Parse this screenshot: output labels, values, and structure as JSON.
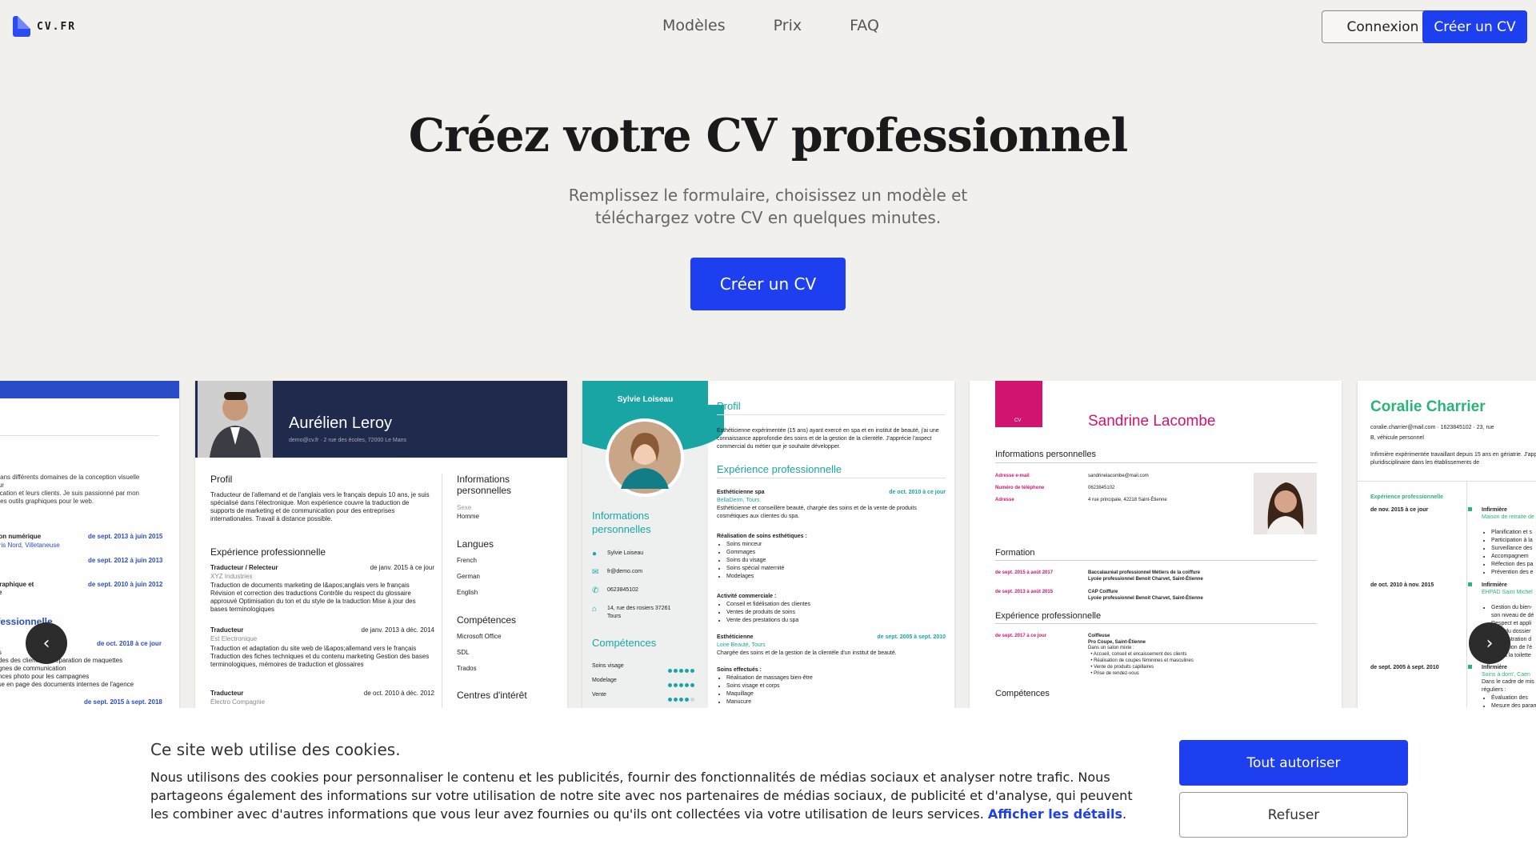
{
  "nav": {
    "logo_text": "CV.FR",
    "links": [
      "Modèles",
      "Prix",
      "FAQ"
    ],
    "login_label": "Connexion",
    "create_label": "Créer un CV"
  },
  "hero": {
    "title": "Créez votre CV professionnel",
    "subtitle": "Remplissez le formulaire, choisissez un modèle et téléchargez votre CV en quelques minutes.",
    "cta_label": "Créer un CV"
  },
  "templates": {
    "card1": {
      "lines": [
        "de sept. 2013 à juin 2015",
        "de sept. 2012 à juin 2013",
        "de sept. 2010 à juin 2012",
        "ofessionnelle",
        "de oct. 2018 à ce jour",
        "de sept. 2015 à sept. 2018"
      ]
    },
    "card2": {
      "name": "Aurélien Leroy",
      "contact": "demo@cv.fr · 2 rue des écoles, 72000 Le Mans",
      "profil_title": "Profil",
      "profil_text": "Traducteur de l'allemand et de l'anglais vers le français depuis 10 ans, je suis spécialisé dans l'électronique. Mon expérience couvre la traduction de supports de marketing et de communication pour des entreprises internationales. Travail à distance possible.",
      "exp_title": "Expérience professionnelle",
      "jobs": [
        {
          "title": "Traducteur / Relecteur",
          "date": "de janv. 2015 à ce jour",
          "company": "XYZ Industries"
        },
        {
          "title": "Traducteur",
          "date": "de janv. 2013 à déc. 2014",
          "company": "Est Electronique"
        },
        {
          "title": "Traducteur",
          "date": "de oct. 2010 à déc. 2012",
          "company": "Électro Compagnie"
        }
      ],
      "side": {
        "info_title": "Informations personnelles",
        "sexe_label": "Sexe",
        "sexe": "Homme",
        "lang_title": "Langues",
        "langs": [
          "French",
          "German",
          "English"
        ],
        "skills_title": "Compétences",
        "skills": [
          "Microsoft Office",
          "SDL",
          "Trados"
        ],
        "interests_title": "Centres d'intérêt"
      }
    },
    "card3": {
      "name": "Sylvie Loiseau",
      "info_title": "Informations personnelles",
      "contacts": [
        "Sylvie Loiseau",
        "fr@demo.com",
        "0623845102",
        "14, rue des rosiers 37261 Tours"
      ],
      "skills_title": "Compétences",
      "skills": [
        "Soins visage",
        "Modelage",
        "Vente"
      ],
      "profil_title": "Profil",
      "profil_text": "Esthéticienne expérimentée (15 ans) ayant exercé en spa et en institut de beauté, j'ai une connaissance approfondie des soins et de la gestion de la clientèle. J'apprécie l'aspect commercial du métier que je souhaite développer.",
      "exp_title": "Expérience professionnelle",
      "job1_title": "Esthéticienne spa",
      "job1_date": "de oct. 2010 à ce jour",
      "job1_company": "BellaDerm, Tours",
      "job2_title": "Esthéticienne",
      "job2_date": "de sept. 2005 à sept. 2010",
      "job2_company": "Loire Beauté, Tours"
    },
    "card4": {
      "badge": "CV",
      "name": "Sandrine Lacombe",
      "info_title": "Informations personnelles",
      "email_label": "Adresse e-mail",
      "email": "sandrinelacombe@mail.com",
      "phone_label": "Numéro de téléphone",
      "phone": "0623845102",
      "address_label": "Adresse",
      "address": "4 rue principale, 42218 Saint-Étienne",
      "formation_title": "Formation",
      "formation": [
        {
          "date": "de sept. 2015 à août 2017",
          "text": "Baccalauréat professionnel Métiers de la coiffure"
        },
        {
          "date": "de sept. 2013 à août 2015",
          "text": "CAP Coiffure"
        }
      ],
      "exp_title": "Expérience professionnelle",
      "exp_date": "de sept. 2017 à ce jour",
      "exp_role": "Coiffeuse",
      "exp_company": "Pro Coupe, Saint-Étienne",
      "skills_title": "Compétences"
    },
    "card5": {
      "name": "Coralie Charrier",
      "contact": "coralie.charrier@mail.com · 1623845102 · 23, rue",
      "exp_title": "Expérience professionnelle",
      "dates": [
        "de nov. 2015 à ce jour",
        "de oct. 2010 à nov. 2015",
        "de sept. 2005 à sept. 2010"
      ],
      "roles": [
        "Infirmière",
        "Infirmière",
        "Infirmière"
      ]
    }
  },
  "cookie": {
    "title": "Ce site web utilise des cookies.",
    "text": "Nous utilisons des cookies pour personnaliser le contenu et les publicités, fournir des fonctionnalités de médias sociaux et analyser notre trafic. Nous partageons également des informations sur votre utilisation de notre site avec nos partenaires de médias sociaux, de publicité et d'analyse, qui peuvent les combiner avec d'autres informations que vous leur avez fournies ou qu'ils ont collectées via votre utilisation de leurs services.",
    "details_link": "Afficher les détails",
    "allow_label": "Tout autoriser",
    "refuse_label": "Refuser"
  },
  "icons": {
    "prev": "chevron-left-icon",
    "next": "chevron-right-icon"
  },
  "colors": {
    "accent": "#1d3ff0",
    "teal": "#1aa5a5",
    "magenta": "#d1146f",
    "navy": "#1f2a4d",
    "green": "#2bb37a"
  }
}
